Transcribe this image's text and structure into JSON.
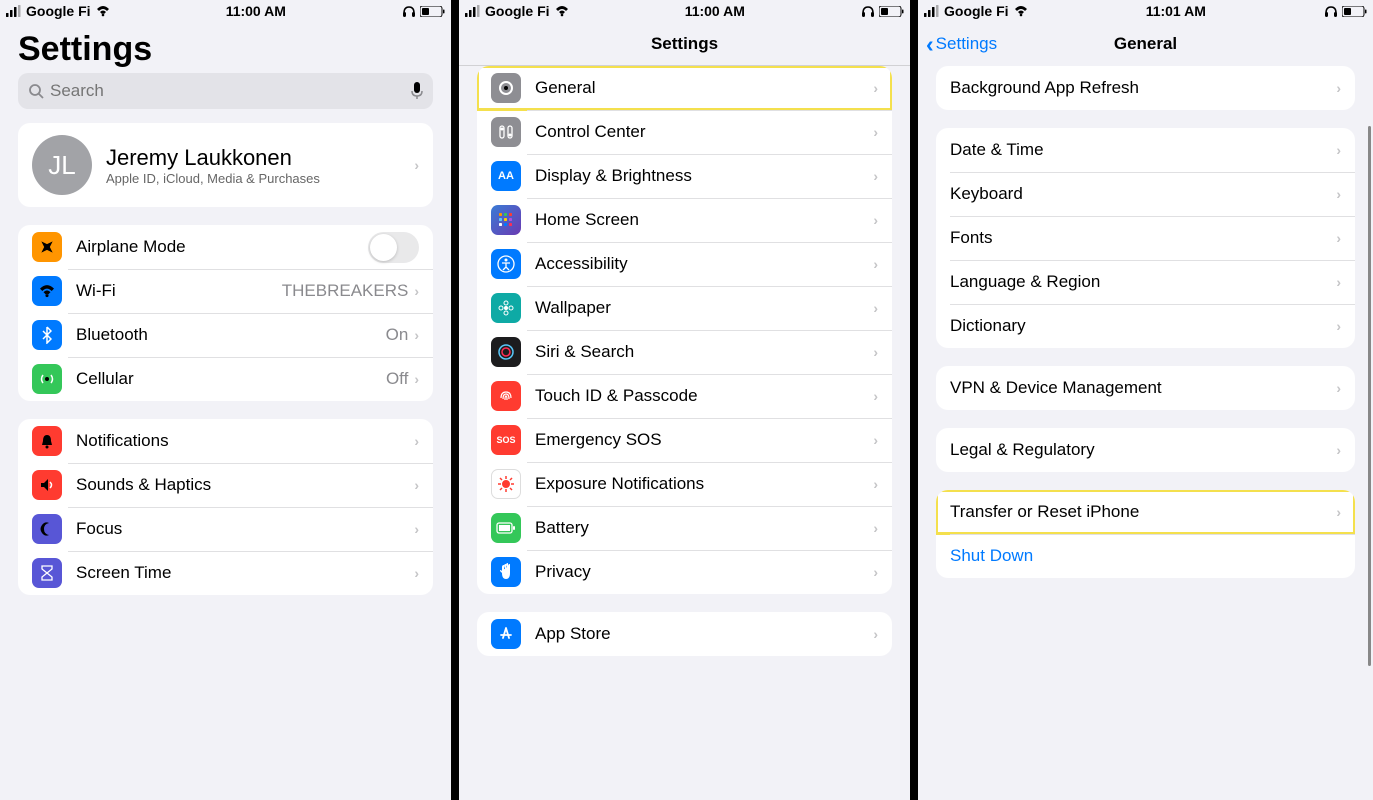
{
  "status": {
    "carrier": "Google Fi",
    "time1": "11:00 AM",
    "time2": "11:00 AM",
    "time3": "11:01 AM"
  },
  "screen1": {
    "title": "Settings",
    "search_placeholder": "Search",
    "profile": {
      "initials": "JL",
      "name": "Jeremy Laukkonen",
      "sub": "Apple ID, iCloud, Media & Purchases"
    },
    "group_connect": [
      {
        "label": "Airplane Mode",
        "type": "toggle"
      },
      {
        "label": "Wi-Fi",
        "detail": "THEBREAKERS"
      },
      {
        "label": "Bluetooth",
        "detail": "On"
      },
      {
        "label": "Cellular",
        "detail": "Off"
      }
    ],
    "group_notif": [
      {
        "label": "Notifications"
      },
      {
        "label": "Sounds & Haptics"
      },
      {
        "label": "Focus"
      },
      {
        "label": "Screen Time"
      }
    ]
  },
  "screen2": {
    "nav_title": "Settings",
    "items": [
      {
        "label": "General",
        "highlight": true
      },
      {
        "label": "Control Center"
      },
      {
        "label": "Display & Brightness"
      },
      {
        "label": "Home Screen"
      },
      {
        "label": "Accessibility"
      },
      {
        "label": "Wallpaper"
      },
      {
        "label": "Siri & Search"
      },
      {
        "label": "Touch ID & Passcode"
      },
      {
        "label": "Emergency SOS"
      },
      {
        "label": "Exposure Notifications"
      },
      {
        "label": "Battery"
      },
      {
        "label": "Privacy"
      }
    ],
    "next_group_first": "App Store"
  },
  "screen3": {
    "nav_back": "Settings",
    "nav_title": "General",
    "group_top": [
      {
        "label": "Background App Refresh"
      }
    ],
    "group_mid": [
      {
        "label": "Date & Time"
      },
      {
        "label": "Keyboard"
      },
      {
        "label": "Fonts"
      },
      {
        "label": "Language & Region"
      },
      {
        "label": "Dictionary"
      }
    ],
    "group_vpn": [
      {
        "label": "VPN & Device Management"
      }
    ],
    "group_legal": [
      {
        "label": "Legal & Regulatory"
      }
    ],
    "group_reset": [
      {
        "label": "Transfer or Reset iPhone",
        "highlight": true
      },
      {
        "label": "Shut Down",
        "blue": true,
        "no_chevron": true
      }
    ]
  }
}
